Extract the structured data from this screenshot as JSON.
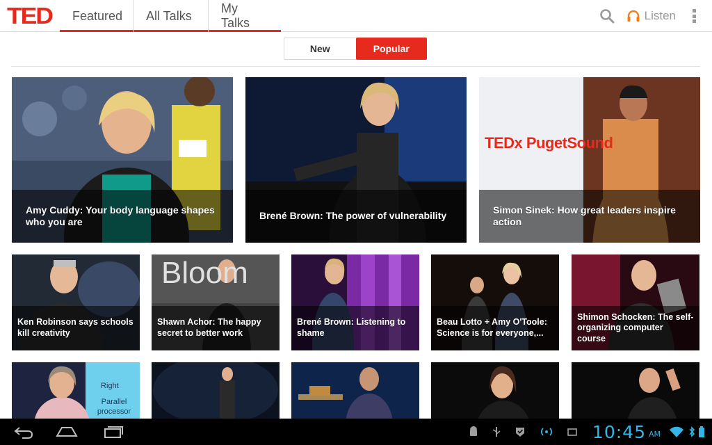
{
  "app": {
    "logo": "TED",
    "tabs": [
      {
        "label": "Featured",
        "active": true
      },
      {
        "label": "All Talks",
        "active": false
      },
      {
        "label": "My Talks",
        "active": false
      }
    ],
    "listen_label": "Listen",
    "accent_color": "#e62b1e"
  },
  "segment": {
    "options": [
      "New",
      "Popular"
    ],
    "selected": "Popular"
  },
  "talks_featured": [
    {
      "title": "Amy Cuddy: Your body language shapes who you are"
    },
    {
      "title": "Brené Brown: The power of vulnerability"
    },
    {
      "title": "Simon Sinek: How great leaders inspire action"
    }
  ],
  "talks_row2": [
    {
      "title": "Ken Robinson says schools kill creativity"
    },
    {
      "title": "Shawn Achor: The happy secret to better work"
    },
    {
      "title": "Brené Brown: Listening to shame"
    },
    {
      "title": "Beau Lotto + Amy O'Toole: Science is for everyone,..."
    },
    {
      "title": "Shimon Schocken: The self-organizing computer course"
    }
  ],
  "tile_text": {
    "tedx_sign": "TEDx PugetSound",
    "bloom_sign": "Bloom",
    "right_sign": "Right",
    "parallel_sign": "Parallel processor"
  },
  "system": {
    "time": "10:45",
    "ampm": "AM",
    "clock_color": "#33b5e5"
  }
}
